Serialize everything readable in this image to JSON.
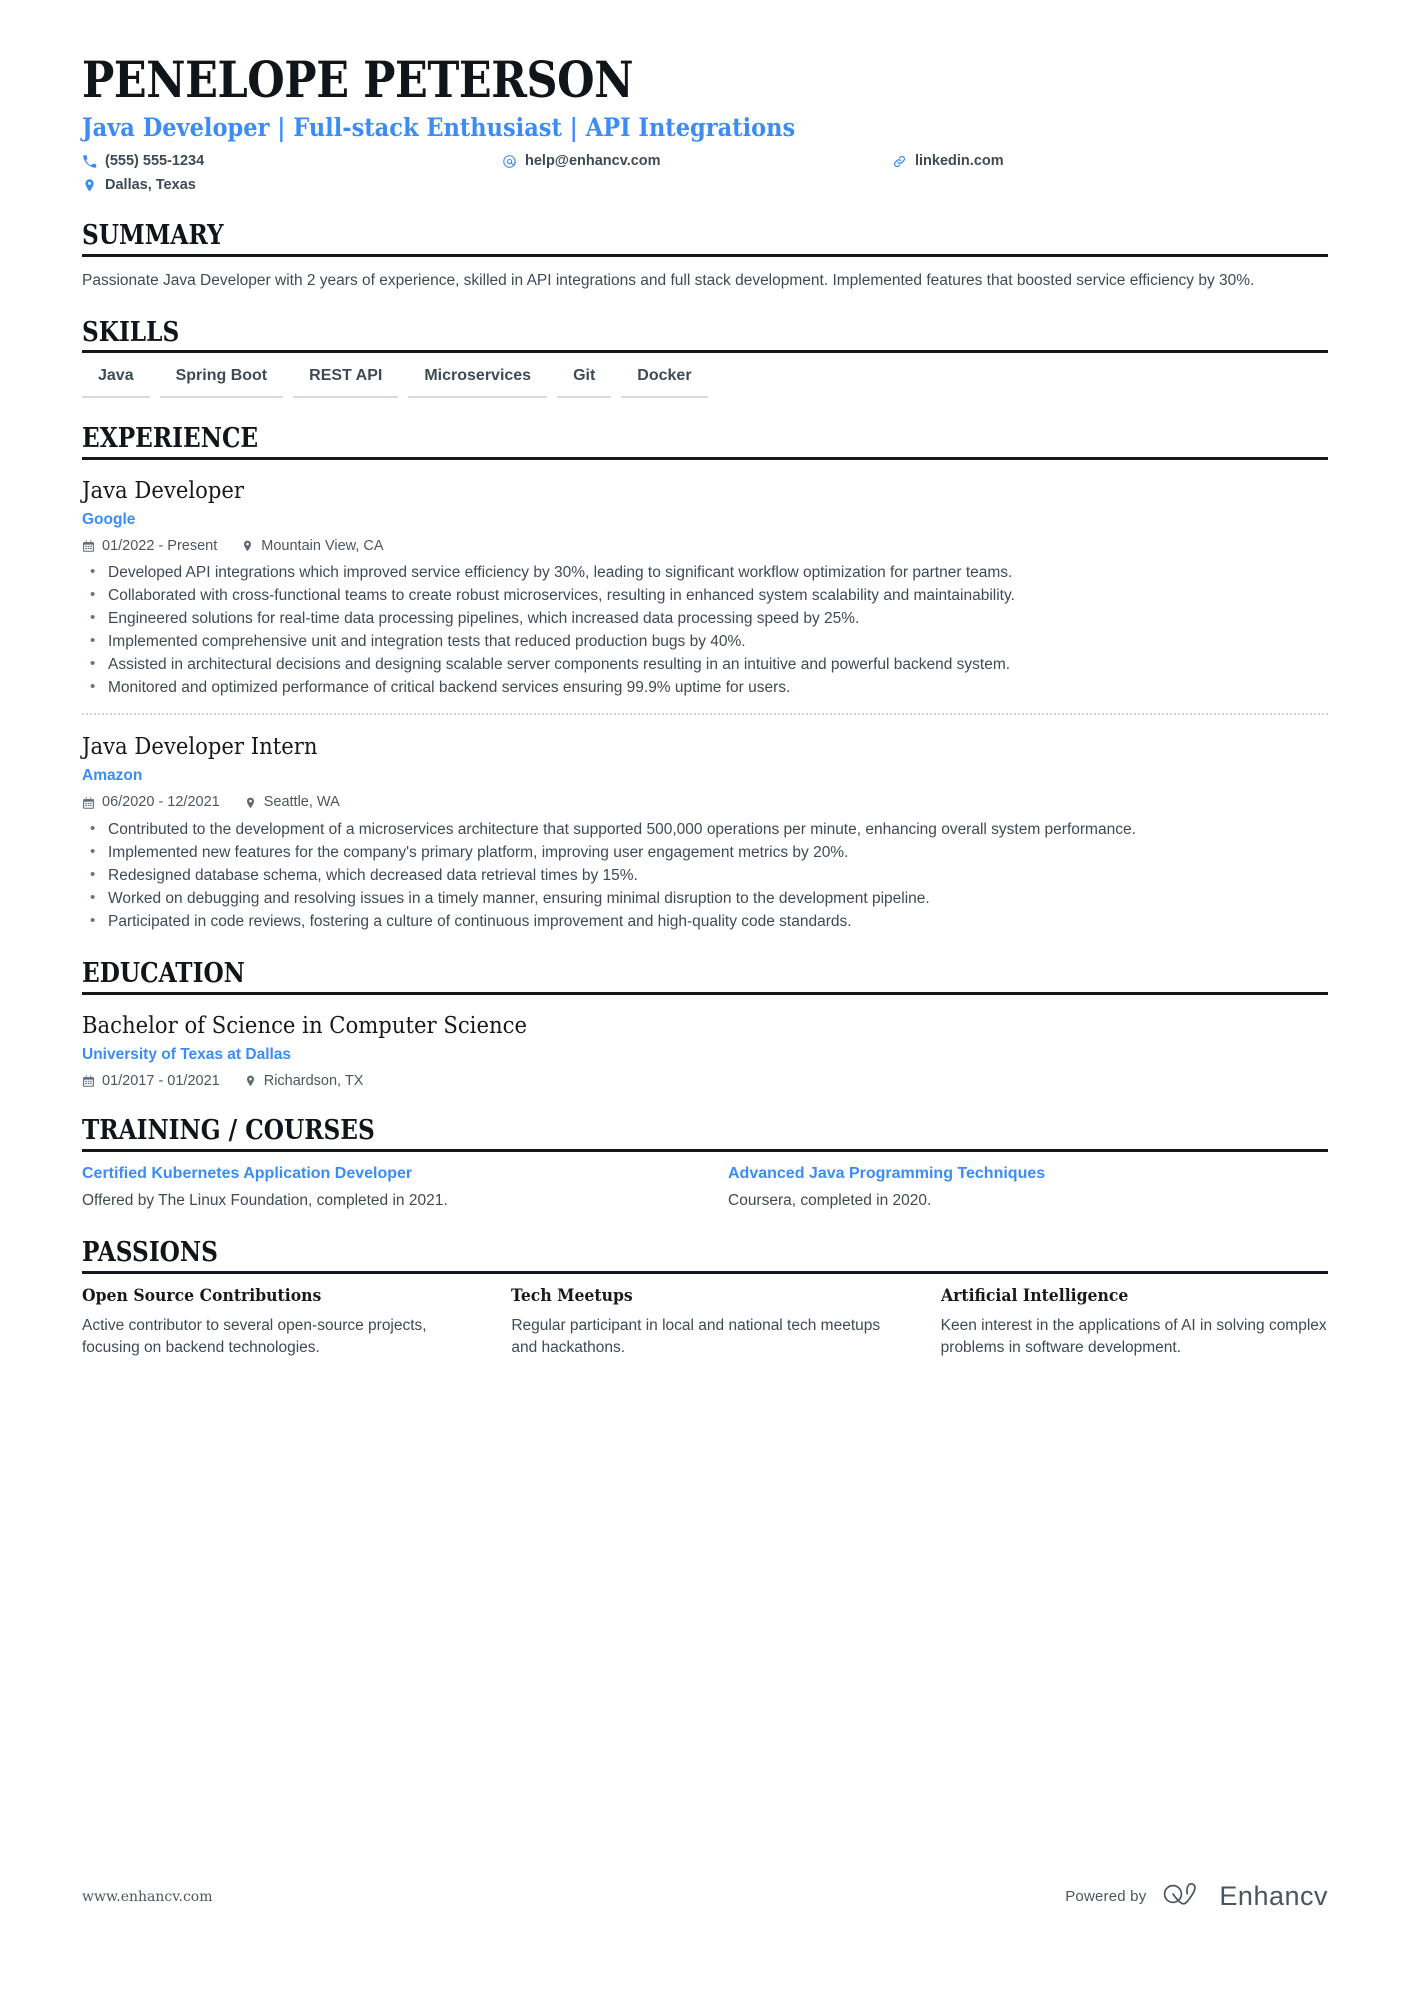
{
  "header": {
    "name": "PENELOPE PETERSON",
    "headline": "Java Developer | Full-stack Enthusiast | API Integrations",
    "contacts": [
      {
        "icon": "phone-icon",
        "text": "(555) 555-1234"
      },
      {
        "icon": "email-icon",
        "text": "help@enhancv.com"
      },
      {
        "icon": "link-icon",
        "text": "linkedin.com"
      },
      {
        "icon": "location-icon",
        "text": "Dallas, Texas"
      }
    ]
  },
  "summary": {
    "title": "SUMMARY",
    "text": "Passionate Java Developer with 2 years of experience, skilled in API integrations and full stack development. Implemented features that boosted service efficiency by 30%."
  },
  "skills": {
    "title": "SKILLS",
    "items": [
      "Java",
      "Spring Boot",
      "REST API",
      "Microservices",
      "Git",
      "Docker"
    ]
  },
  "experience": {
    "title": "EXPERIENCE",
    "entries": [
      {
        "role": "Java Developer",
        "company": "Google",
        "dates": "01/2022 - Present",
        "location": "Mountain View, CA",
        "bullets": [
          "Developed API integrations which improved service efficiency by 30%, leading to significant workflow optimization for partner teams.",
          "Collaborated with cross-functional teams to create robust microservices, resulting in enhanced system scalability and maintainability.",
          "Engineered solutions for real-time data processing pipelines, which increased data processing speed by 25%.",
          "Implemented comprehensive unit and integration tests that reduced production bugs by 40%.",
          "Assisted in architectural decisions and designing scalable server components resulting in an intuitive and powerful backend system.",
          "Monitored and optimized performance of critical backend services ensuring 99.9% uptime for users."
        ]
      },
      {
        "role": "Java Developer Intern",
        "company": "Amazon",
        "dates": "06/2020 - 12/2021",
        "location": "Seattle, WA",
        "bullets": [
          "Contributed to the development of a microservices architecture that supported 500,000 operations per minute, enhancing overall system performance.",
          "Implemented new features for the company's primary platform, improving user engagement metrics by 20%.",
          "Redesigned database schema, which decreased data retrieval times by 15%.",
          "Worked on debugging and resolving issues in a timely manner, ensuring minimal disruption to the development pipeline.",
          "Participated in code reviews, fostering a culture of continuous improvement and high-quality code standards."
        ]
      }
    ]
  },
  "education": {
    "title": "EDUCATION",
    "entries": [
      {
        "degree": "Bachelor of Science in Computer Science",
        "school": "University of Texas at Dallas",
        "dates": "01/2017 - 01/2021",
        "location": "Richardson, TX"
      }
    ]
  },
  "training": {
    "title": "TRAINING / COURSES",
    "items": [
      {
        "name": "Certified Kubernetes Application Developer",
        "desc": "Offered by The Linux Foundation, completed in 2021."
      },
      {
        "name": "Advanced Java Programming Techniques",
        "desc": "Coursera, completed in 2020."
      }
    ]
  },
  "passions": {
    "title": "PASSIONS",
    "items": [
      {
        "name": "Open Source Contributions",
        "desc": "Active contributor to several open-source projects, focusing on backend technologies."
      },
      {
        "name": "Tech Meetups",
        "desc": "Regular participant in local and national tech meetups and hackathons."
      },
      {
        "name": "Artificial Intelligence",
        "desc": "Keen interest in the applications of AI in solving complex problems in software development."
      }
    ]
  },
  "footer": {
    "url": "www.enhancv.com",
    "powered_label": "Powered by",
    "brand": "Enhancv"
  },
  "colors": {
    "accent": "#3b8cf4",
    "text": "#3f4a55",
    "heading": "#15191e",
    "rule": "#15191e",
    "skill_underline": "#d7dade"
  }
}
